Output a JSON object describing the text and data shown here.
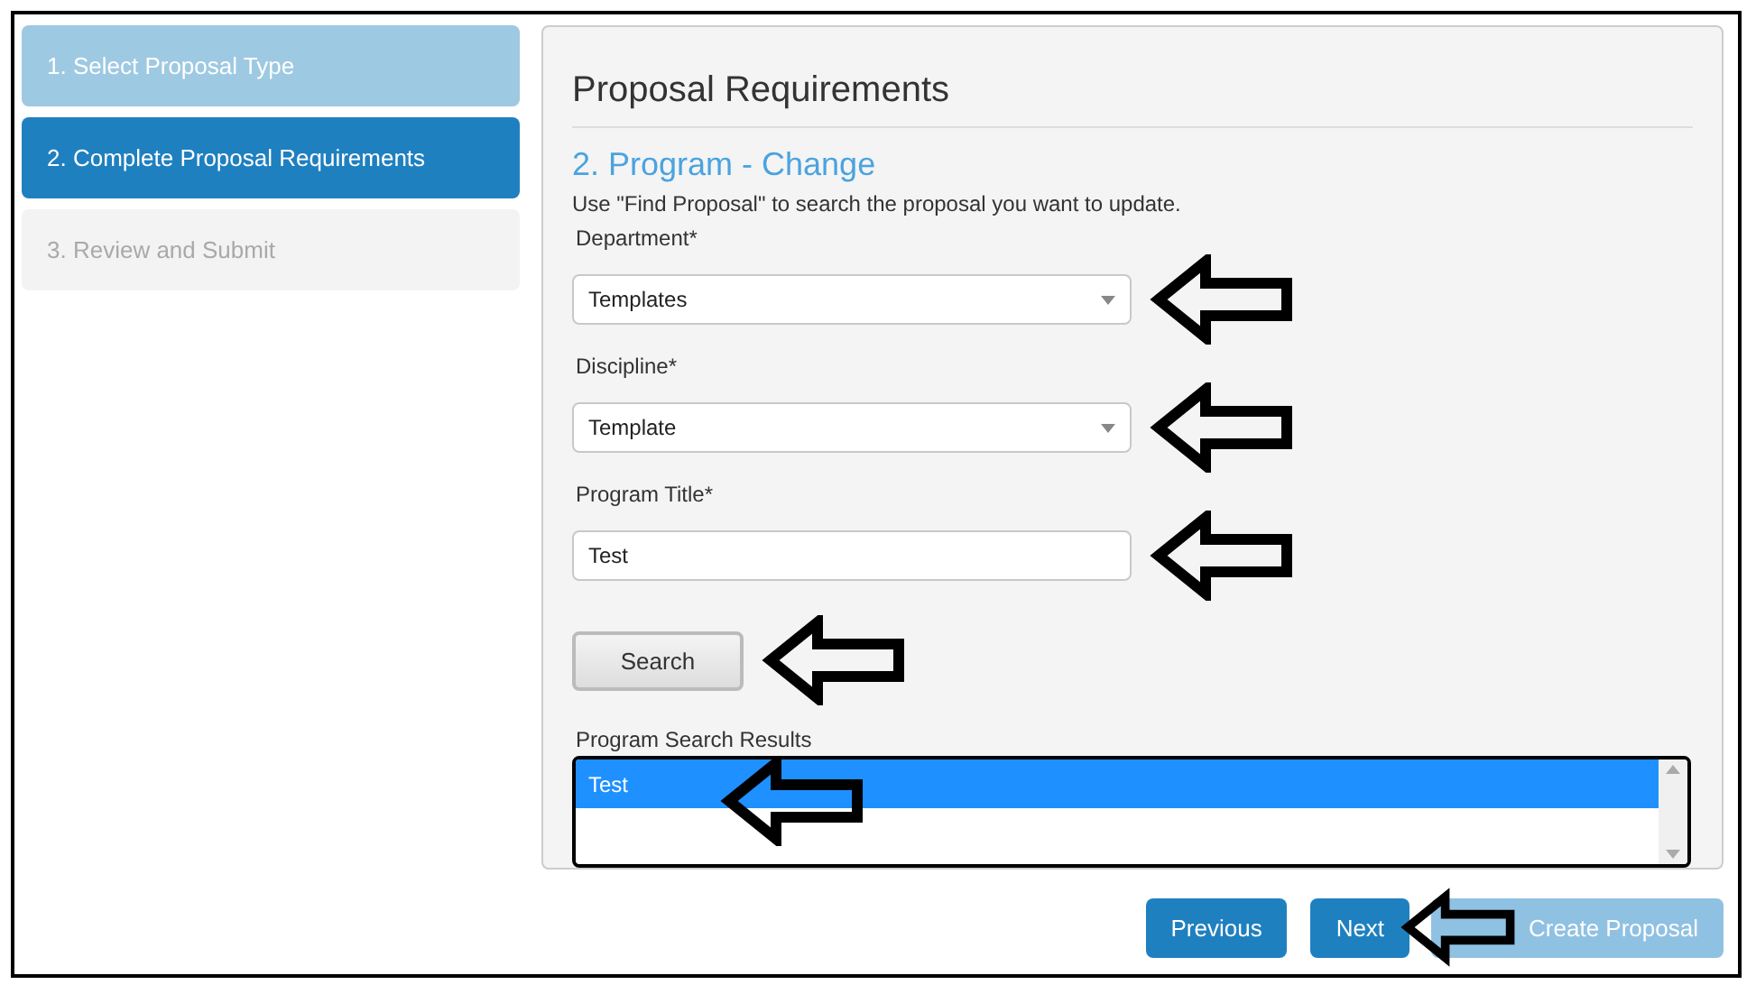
{
  "steps": [
    {
      "label": "1. Select Proposal Type",
      "selected": false,
      "disabled": false
    },
    {
      "label": "2. Complete Proposal Requirements",
      "selected": true,
      "disabled": false
    },
    {
      "label": "3. Review and Submit",
      "selected": false,
      "disabled": true
    }
  ],
  "panel": {
    "title": "Proposal Requirements",
    "subtitle": "2. Program - Change",
    "instructions": "Use \"Find Proposal\" to search the proposal you want to update.",
    "fields": [
      {
        "kind": "select",
        "label": "Department*",
        "value": "Templates"
      },
      {
        "kind": "select",
        "label": "Discipline*",
        "value": "Template"
      },
      {
        "kind": "text",
        "label": "Program Title*",
        "value": "Test"
      }
    ],
    "search_button": "Search",
    "results": {
      "label": "Program Search Results",
      "items": [
        {
          "label": "Test",
          "selected": true
        }
      ]
    }
  },
  "buttons": [
    {
      "label": "Previous",
      "disabled": false
    },
    {
      "label": "Next",
      "disabled": false
    },
    {
      "label": "Create Proposal",
      "disabled": true
    }
  ]
}
